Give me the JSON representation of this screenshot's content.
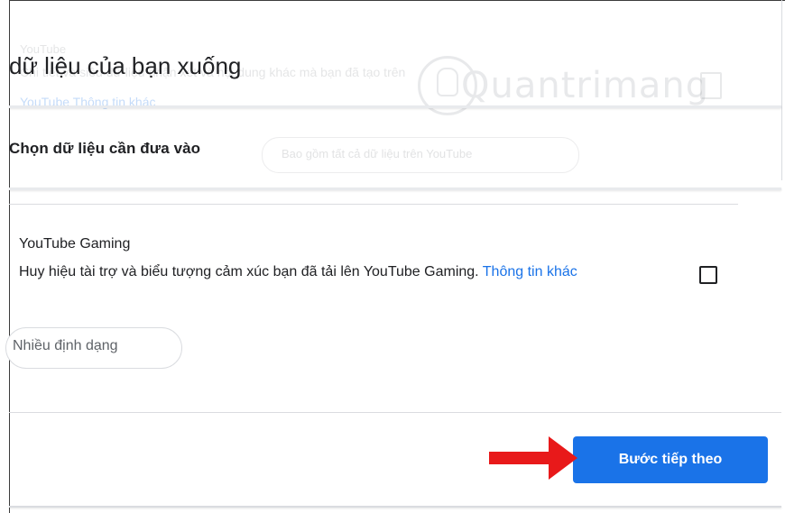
{
  "background": {
    "prev_item_title": "YouTube",
    "prev_item_desc": "Chi tiết và siêu dữ liệu nhận xét và nội dung khác mà bạn đã tạo trên",
    "prev_item_link": "YouTube Thông tin khác",
    "prev_chip": "Bao gồm tất cả dữ liệu trên YouTube"
  },
  "watermark": {
    "text": "Quantrimang",
    "icon": "lightbulb-icon"
  },
  "header": {
    "title": "dữ liệu của bạn xuống"
  },
  "section": {
    "title": "Chọn dữ liệu cần đưa vào"
  },
  "item": {
    "title": "YouTube Gaming",
    "description": "Huy hiệu tài trợ và biểu tượng cảm xúc bạn đã tải lên YouTube Gaming. ",
    "link": "Thông tin khác",
    "checked": false,
    "format_chip": "Nhiều định dạng"
  },
  "footer": {
    "next_button": "Bước tiếp theo"
  },
  "colors": {
    "accent": "#1a73e8",
    "arrow": "#e8191a",
    "text": "#202124",
    "muted": "#5f6368"
  },
  "icons": {
    "arrow": "red-arrow-icon",
    "checkbox": "checkbox-icon"
  }
}
